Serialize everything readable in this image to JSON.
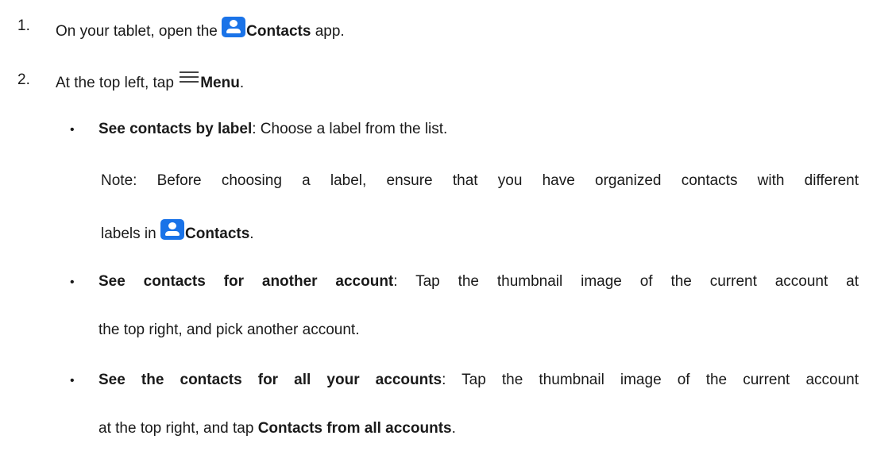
{
  "steps": [
    {
      "number": "1.",
      "before": "On your tablet, open the ",
      "bold": "Contacts",
      "after": " app."
    },
    {
      "number": "2.",
      "before": "At the top left, tap ",
      "bold": "Menu",
      "after": "."
    }
  ],
  "bullets": [
    {
      "marker": "•",
      "bold": "See contacts by label",
      "text": ": Choose a label from the list.",
      "note_line1": "Note: Before choosing a label, ensure that you have organized contacts with different",
      "note_line2_before": "labels in ",
      "note_line2_bold": "Contacts",
      "note_line2_after": "."
    },
    {
      "marker": "•",
      "bold": "See contacts for another account",
      "text_line1": ": Tap the thumbnail image of the current account at",
      "text_line2": "the top right, and pick another account."
    },
    {
      "marker": "•",
      "bold": "See the contacts for all your accounts",
      "text_line1": ": Tap the thumbnail image of the current account",
      "text_line2_before": "at the top right, and tap ",
      "text_line2_bold": "Contacts from all accounts",
      "text_line2_after": "."
    }
  ],
  "icons": {
    "contacts_color": "#1a73e8",
    "contacts_icon": "contacts-app-icon",
    "menu_icon": "hamburger-menu-icon"
  }
}
